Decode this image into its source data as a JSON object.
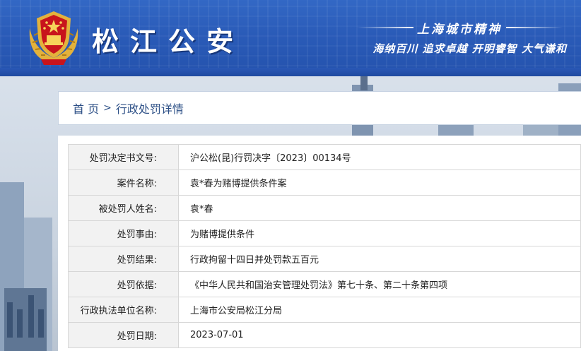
{
  "header": {
    "site_title": "松江公安",
    "spirit_title": "上海城市精神",
    "spirit_slogan": "海纳百川 追求卓越 开明睿智 大气谦和",
    "colors": {
      "header_blue": "#2a5bb8",
      "accent_red": "#c8141c",
      "gold": "#e3b23c"
    },
    "emblem_icon": "police-emblem-icon"
  },
  "breadcrumb": {
    "home_label": "首 页",
    "separator": ">",
    "current_label": "行政处罚详情"
  },
  "detail": {
    "rows": [
      {
        "label": "处罚决定书文号:",
        "value": "沪公松(昆)行罚决字〔2023〕00134号"
      },
      {
        "label": "案件名称:",
        "value": "袁*春为赌博提供条件案"
      },
      {
        "label": "被处罚人姓名:",
        "value": "袁*春"
      },
      {
        "label": "处罚事由:",
        "value": "为赌博提供条件"
      },
      {
        "label": "处罚结果:",
        "value": "行政拘留十四日并处罚款五百元"
      },
      {
        "label": "处罚依据:",
        "value": "《中华人民共和国治安管理处罚法》第七十条、第二十条第四项"
      },
      {
        "label": "行政执法单位名称:",
        "value": "上海市公安局松江分局"
      },
      {
        "label": "处罚日期:",
        "value": "2023-07-01"
      }
    ]
  }
}
